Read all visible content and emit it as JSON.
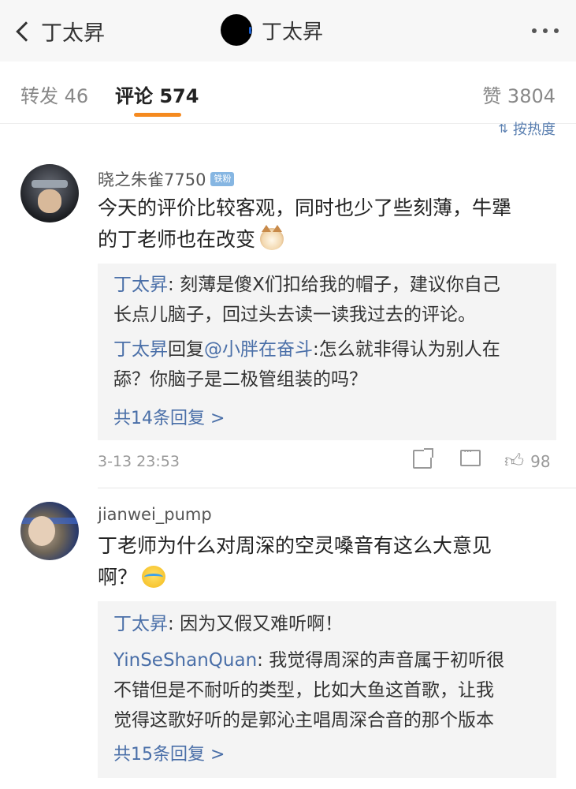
{
  "nav": {
    "back_label": "丁太昇",
    "title": "丁太昇",
    "more_label": "more"
  },
  "tabs": {
    "repost_label": "转发",
    "repost_count": "46",
    "comment_label": "评论",
    "comment_count": "574",
    "like_label": "赞",
    "like_count": "3804"
  },
  "sort": {
    "label": "按热度"
  },
  "colors": {
    "accent": "#f58a1f",
    "link": "#4a6fa8",
    "reply_bg": "#f4f4f4"
  },
  "comments": [
    {
      "username": "晓之朱雀7750",
      "badge": "铁粉",
      "text_line1": "今天的评价比较客观，同时也少了些刻薄，牛犟",
      "text_line2": "的丁老师也在改变",
      "emoji": "cat-face-icon",
      "replies": [
        {
          "author": "丁太昇",
          "sep": ": ",
          "line1": "刻薄是傻X们扣给我的帽子，建议你自己",
          "line2": "长点儿脑子，回过头去读一读我过去的评论。"
        },
        {
          "author": "丁太昇",
          "action": "回复",
          "mention": "@小胖在奋斗",
          "sep": ":",
          "line1": "怎么就非得认为别人在",
          "line2": "舔？你脑子是二极管组装的吗？"
        }
      ],
      "more_replies": "共14条回复 >",
      "time": "3-13 23:53",
      "likes": "98"
    },
    {
      "username": "jianwei_pump",
      "text_line1": "丁老师为什么对周深的空灵嗓音有这么大意见",
      "text_line2": "啊？",
      "emoji": "crying-laughing-icon",
      "replies": [
        {
          "author": "丁太昇",
          "sep": ": ",
          "line1": "因为又假又难听啊！"
        },
        {
          "author": "YinSeShanQuan",
          "sep": ": ",
          "line1": "我觉得周深的声音属于初听很",
          "line2": "不错但是不耐听的类型，比如大鱼这首歌，让我",
          "line3": "觉得这歌好听的是郭沁主唱周深合音的那个版本"
        }
      ],
      "more_replies": "共15条回复 >"
    }
  ]
}
